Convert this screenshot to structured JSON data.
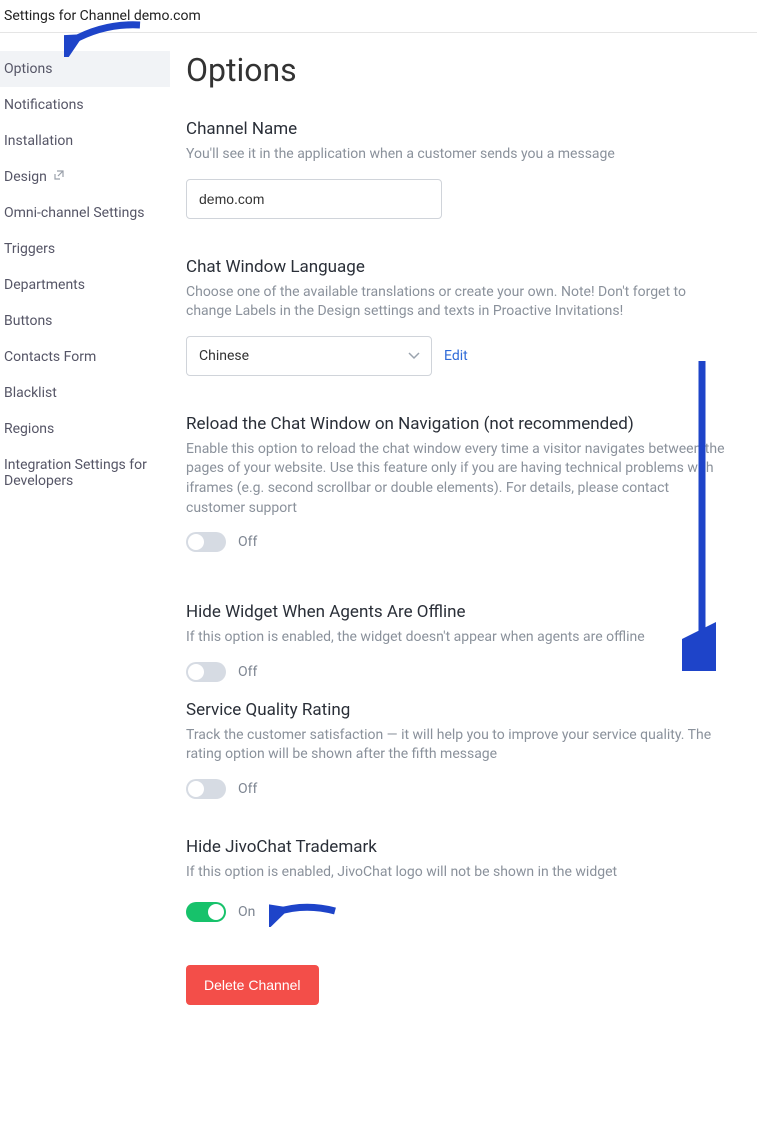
{
  "topbar": {
    "title": "Settings for Channel demo.com"
  },
  "sidebar": {
    "items": [
      {
        "label": "Options"
      },
      {
        "label": "Notifications"
      },
      {
        "label": "Installation"
      },
      {
        "label": "Design"
      },
      {
        "label": "Omni-channel Settings"
      },
      {
        "label": "Triggers"
      },
      {
        "label": "Departments"
      },
      {
        "label": "Buttons"
      },
      {
        "label": "Contacts Form"
      },
      {
        "label": "Blacklist"
      },
      {
        "label": "Regions"
      },
      {
        "label": "Integration Settings for Developers"
      }
    ]
  },
  "page": {
    "heading": "Options",
    "channel_name": {
      "title": "Channel Name",
      "desc": "You'll see it in the application when a customer sends you a message",
      "value": "demo.com"
    },
    "language": {
      "title": "Chat Window Language",
      "desc": "Choose one of the available translations or create your own. Note! Don't forget to change Labels in the Design settings and texts in Proactive Invitations!",
      "selected": "Chinese",
      "edit_label": "Edit"
    },
    "reload": {
      "title": "Reload the Chat Window on Navigation (not recommended)",
      "desc": "Enable this option to reload the chat window every time a visitor navigates between the pages of your website. Use this feature only if you are having technical problems with iframes (e.g. second scrollbar or double elements). For details, please contact customer support",
      "state_label": "Off"
    },
    "hide_widget": {
      "title": "Hide Widget When Agents Are Offline",
      "desc": "If this option is enabled, the widget doesn't appear when agents are offline",
      "state_label": "Off"
    },
    "quality": {
      "title": "Service Quality Rating",
      "desc": "Track the customer satisfaction — it will help you to improve your service quality. The rating option will be shown after the fifth message",
      "state_label": "Off"
    },
    "trademark": {
      "title": "Hide JivoChat Trademark",
      "desc": "If this option is enabled, JivoChat logo will not be shown in the widget",
      "state_label": "On"
    },
    "delete_label": "Delete Channel"
  }
}
